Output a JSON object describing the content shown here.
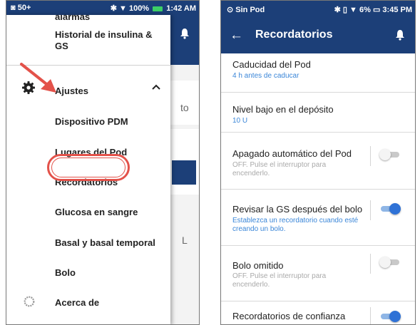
{
  "left_screen": {
    "status_bar": {
      "left": "50+",
      "battery": "100%",
      "time": "1:42 AM"
    },
    "menu_cutoff_text": "alarmas",
    "menu": {
      "history": "Historial de insulina & GS",
      "settings": "Ajustes",
      "pdm_device": "Dispositivo PDM",
      "pod_sites": "Lugares del Pod",
      "reminders": "Recordatorios",
      "blood_glucose": "Glucosa en sangre",
      "basal": "Basal y basal temporal",
      "bolus": "Bolo",
      "about": "Acerca de"
    },
    "background_text": {
      "to": "to",
      "l": "L"
    },
    "colors": {
      "header": "#1c3f78",
      "highlight": "#e3524a"
    }
  },
  "right_screen": {
    "status_bar": {
      "left": "Sin Pod",
      "battery": "6%",
      "time": "3:45 PM"
    },
    "title": "Recordatorios",
    "settings": [
      {
        "title": "Caducidad del Pod",
        "subtitle": "4 h antes de caducar"
      },
      {
        "title": "Nivel bajo en el depósito",
        "subtitle": "10 U"
      },
      {
        "title": "Apagado automático del Pod",
        "subtitle": "OFF. Pulse el interruptor para encenderlo.",
        "toggle": "off"
      },
      {
        "title": "Revisar la GS después del bolo",
        "subtitle": "Establezca un recordatorio cuando esté creando un bolo.",
        "toggle": "on"
      },
      {
        "title": "Bolo omitido",
        "subtitle": "OFF. Pulse el interruptor para encenderlo.",
        "toggle": "off"
      },
      {
        "title": "Recordatorios de confianza",
        "toggle": "on"
      }
    ],
    "colors": {
      "appbar": "#1c3f78",
      "accent": "#2f72d6",
      "subtitle": "#3a86d8"
    }
  }
}
